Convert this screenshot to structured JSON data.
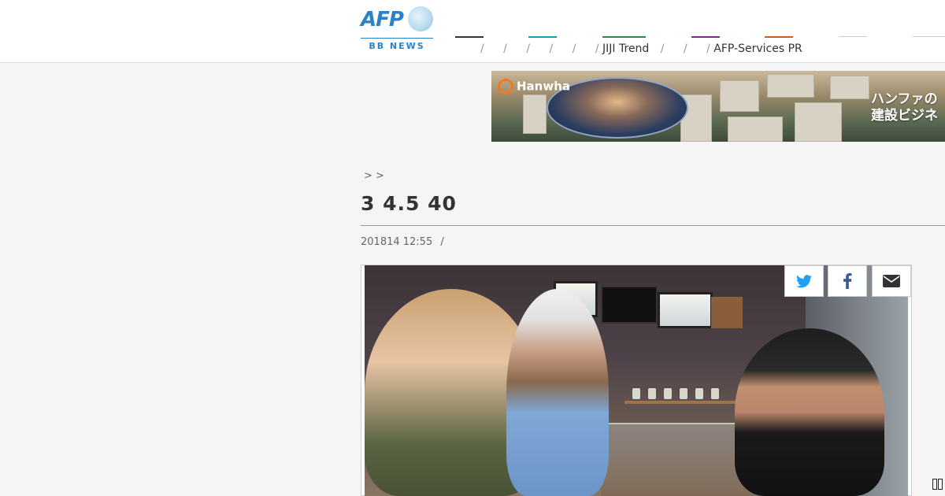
{
  "header": {
    "logo_text": "AFP",
    "logo_sub": "BB NEWS",
    "nav_bars": [
      {
        "color": "#333333"
      },
      {
        "color": "#1a9bb0"
      },
      {
        "color": "#2e8b3a"
      },
      {
        "color": "#7a2b8c"
      },
      {
        "color": "#c0602a"
      },
      {
        "color": "#cccccc"
      },
      {
        "color": "#cccccc"
      }
    ],
    "nav": {
      "separator": "/",
      "jiji_trend": "JIJI Trend",
      "afp_services": "AFP-Services PR"
    }
  },
  "ad": {
    "brand": "Hanwha",
    "tagline_1": "ハンファの",
    "tagline_2": "建設ビジネ"
  },
  "article": {
    "breadcrumb": ">  >",
    "title": "3 4.5 40",
    "date": "201814 12:55",
    "date_sep": "/"
  },
  "share": {
    "twitter": "twitter-icon",
    "facebook": "facebook-icon",
    "email": "envelope-icon"
  },
  "colors": {
    "accent": "#2a83c8",
    "twitter": "#1da1f2",
    "facebook": "#3b5998",
    "email": "#333333"
  }
}
